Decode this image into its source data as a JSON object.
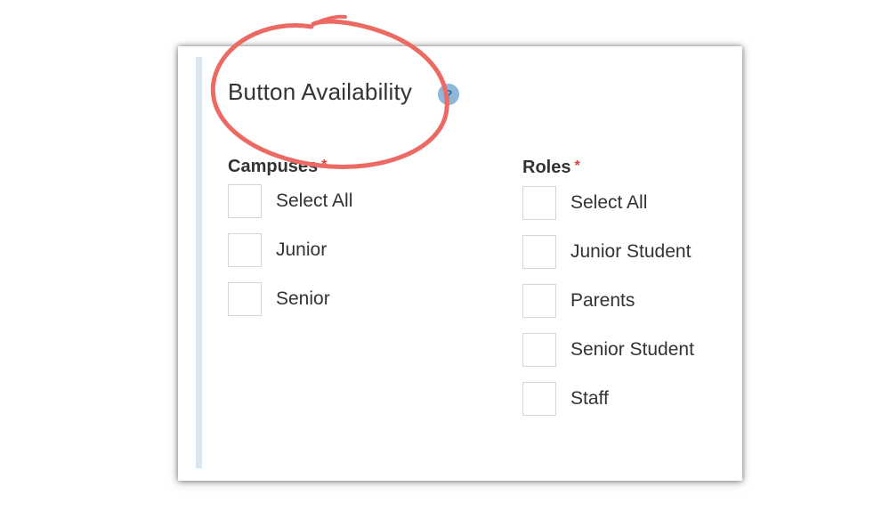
{
  "panel": {
    "title": "Button Availability",
    "help_glyph": "?"
  },
  "campuses": {
    "label": "Campuses",
    "required_mark": "*",
    "options": [
      "Select All",
      "Junior",
      "Senior"
    ]
  },
  "roles": {
    "label": "Roles",
    "required_mark": "*",
    "options": [
      "Select All",
      "Junior Student",
      "Parents",
      "Senior Student",
      "Staff"
    ]
  },
  "colors": {
    "annotation_circle": "#ec6a63",
    "required": "#e0413a",
    "help_icon": "#8fb7d9"
  }
}
